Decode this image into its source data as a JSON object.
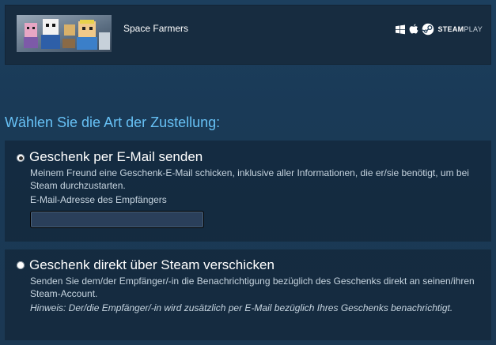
{
  "product": {
    "title": "Space Farmers",
    "platform_icons": [
      "windows-icon",
      "apple-icon",
      "steam-icon"
    ],
    "steamplay_bold": "STEAM",
    "steamplay_light": "PLAY"
  },
  "delivery": {
    "heading": "Wählen Sie die Art der Zustellung:",
    "options": [
      {
        "title": "Geschenk per E-Mail senden",
        "selected": true,
        "description": "Meinem Freund eine Geschenk-E-Mail schicken, inklusive aller Informationen, die er/sie benötigt, um bei Steam durchzustarten.",
        "field_label": "E-Mail-Adresse des Empfängers",
        "field_value": ""
      },
      {
        "title": "Geschenk direkt über Steam verschicken",
        "selected": false,
        "description": "Senden Sie dem/der Empfänger/-in die Benachrichtigung bezüglich des Geschenks direkt an seinen/ihren Steam-Account.",
        "note": "Hinweis: Der/die Empfänger/-in wird zusätzlich per E-Mail bezüglich Ihres Geschenks benachrichtigt."
      }
    ]
  },
  "colors": {
    "accent": "#67c1f5",
    "background": "#1b3853",
    "card": "#13283b"
  }
}
